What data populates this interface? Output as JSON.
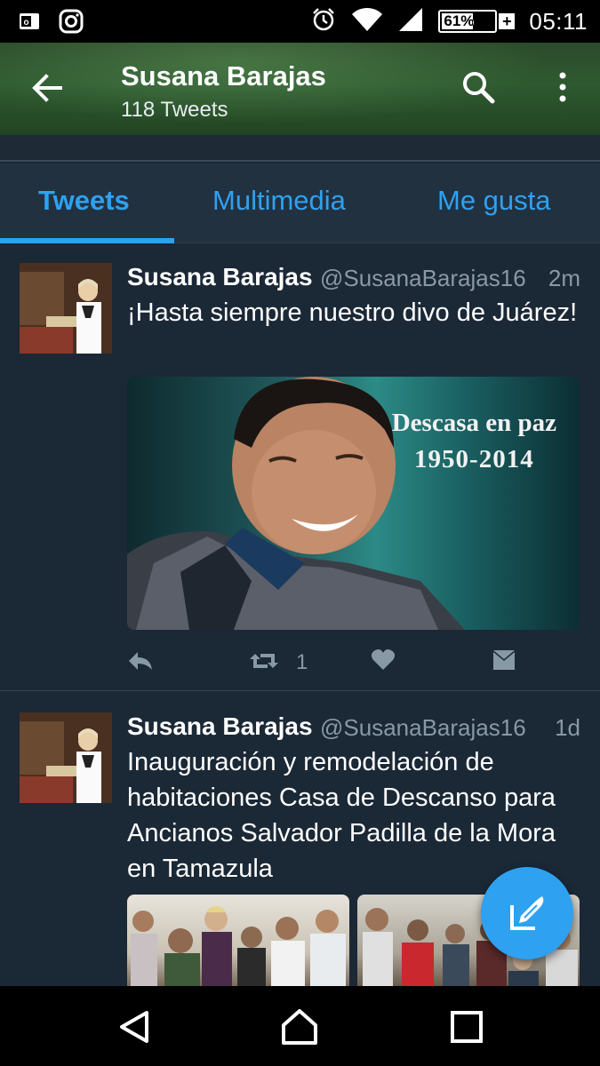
{
  "status_bar": {
    "notification_icons": [
      "outlook-icon",
      "instagram-icon"
    ],
    "system_icons": [
      "alarm-icon",
      "wifi-icon",
      "signal-icon"
    ],
    "battery_percent": "61%",
    "battery_level": 0.61,
    "time": "05:11"
  },
  "header": {
    "title": "Susana Barajas",
    "subtitle": "118 Tweets"
  },
  "tabs": [
    {
      "label": "Tweets",
      "active": true
    },
    {
      "label": "Multimedia",
      "active": false
    },
    {
      "label": "Me gusta",
      "active": false
    }
  ],
  "tweets": [
    {
      "name": "Susana Barajas",
      "handle": "@SusanaBarajas16",
      "time": "2m",
      "text": "¡Hasta siempre nuestro divo de Juárez!",
      "media_caption_line1": "Descasa en paz",
      "media_caption_line2": "1950-2014",
      "retweet_count": "1"
    },
    {
      "name": "Susana Barajas",
      "handle": "@SusanaBarajas16",
      "time": "1d",
      "text": "Inauguración y remodelación de habitaciones Casa de Descanso para Ancianos Salvador Padilla de la Mora en Tamazula"
    }
  ],
  "colors": {
    "background": "#1b2836",
    "accent": "#2ea1f1",
    "muted_text": "#8899a6"
  }
}
